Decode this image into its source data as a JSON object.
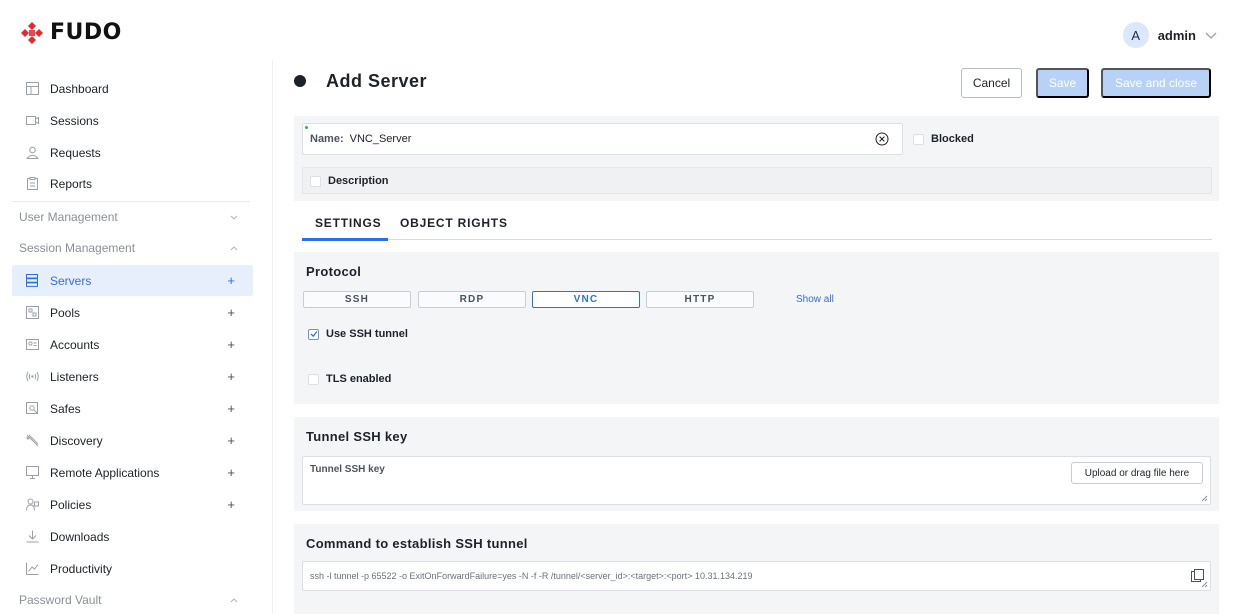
{
  "brand": {
    "logo_text": "FUDO",
    "logo_color": "#e8282e"
  },
  "user": {
    "avatar_initial": "A",
    "name": "admin"
  },
  "sidebar": {
    "items_top": [
      {
        "label": "Dashboard",
        "icon": "dashboard-icon"
      },
      {
        "label": "Sessions",
        "icon": "sessions-icon"
      },
      {
        "label": "Requests",
        "icon": "requests-icon"
      },
      {
        "label": "Reports",
        "icon": "reports-icon"
      }
    ],
    "section_user_mgmt": "User Management",
    "section_session_mgmt": "Session Management",
    "items_session": [
      {
        "label": "Servers",
        "plus": "+",
        "active": true
      },
      {
        "label": "Pools",
        "plus": "+"
      },
      {
        "label": "Accounts",
        "plus": "+"
      },
      {
        "label": "Listeners",
        "plus": "+"
      },
      {
        "label": "Safes",
        "plus": "+"
      },
      {
        "label": "Discovery",
        "plus": "+"
      },
      {
        "label": "Remote Applications",
        "plus": "+"
      },
      {
        "label": "Policies",
        "plus": "+"
      },
      {
        "label": "Downloads"
      },
      {
        "label": "Productivity"
      }
    ],
    "section_password_vault": "Password Vault"
  },
  "header": {
    "title": "Add Server",
    "cancel": "Cancel",
    "save": "Save",
    "save_close": "Save and close"
  },
  "form": {
    "name_label": "Name:",
    "name_value": "VNC_Server",
    "blocked_label": "Blocked",
    "description_label": "Description"
  },
  "tabs": {
    "settings": "SETTINGS",
    "object_rights": "OBJECT RIGHTS"
  },
  "protocol": {
    "title": "Protocol",
    "options": [
      "SSH",
      "RDP",
      "VNC",
      "HTTP"
    ],
    "selected": "VNC",
    "show_all": "Show all",
    "use_ssh_tunnel_label": "Use SSH tunnel",
    "use_ssh_tunnel_checked": true,
    "tls_label": "TLS enabled",
    "tls_checked": false
  },
  "tunnel_key": {
    "title": "Tunnel SSH key",
    "field_label": "Tunnel SSH key",
    "upload_label": "Upload or drag file here"
  },
  "command": {
    "title": "Command to establish SSH tunnel",
    "value": "ssh -l tunnel -p 65522 -o ExitOnForwardFailure=yes -N -f -R /tunnel/<server_id>:<target>:<port> 10.31.134.219"
  },
  "colors": {
    "accent": "#2f6fe6",
    "active_bg": "#e7effc",
    "disabled_save": "#b8d1f7"
  }
}
